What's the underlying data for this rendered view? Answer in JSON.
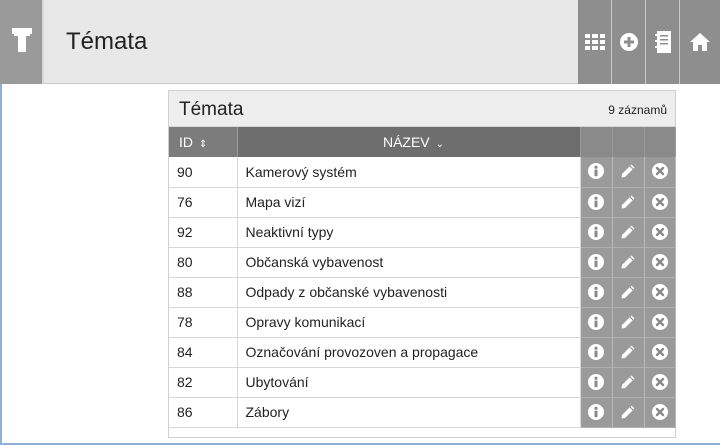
{
  "header": {
    "title": "Témata",
    "tools": [
      {
        "icon": "grid-icon"
      },
      {
        "icon": "add-circle-icon"
      },
      {
        "icon": "notebook-icon"
      },
      {
        "icon": "home-icon"
      }
    ]
  },
  "panel": {
    "title": "Témata",
    "count": "9 záznamů",
    "columns": {
      "id": "ID",
      "name": "NÁZEV"
    },
    "rows": [
      {
        "id": "90",
        "name": "Kamerový systém"
      },
      {
        "id": "76",
        "name": "Mapa vizí"
      },
      {
        "id": "92",
        "name": "Neaktivní typy"
      },
      {
        "id": "80",
        "name": "Občanská vybavenost"
      },
      {
        "id": "88",
        "name": "Odpady z občanské vybavenosti"
      },
      {
        "id": "78",
        "name": "Opravy komunikací"
      },
      {
        "id": "84",
        "name": "Označování provozoven a propagace"
      },
      {
        "id": "82",
        "name": "Ubytování"
      },
      {
        "id": "86",
        "name": "Zábory"
      }
    ]
  },
  "colors": {
    "header_bg": "#e8e8e8",
    "toolbar_bg": "#8e8e8e",
    "table_head_bg": "#7c7c7c",
    "action_bg": "#9a9a9a",
    "frame_border": "#8db0d6"
  }
}
